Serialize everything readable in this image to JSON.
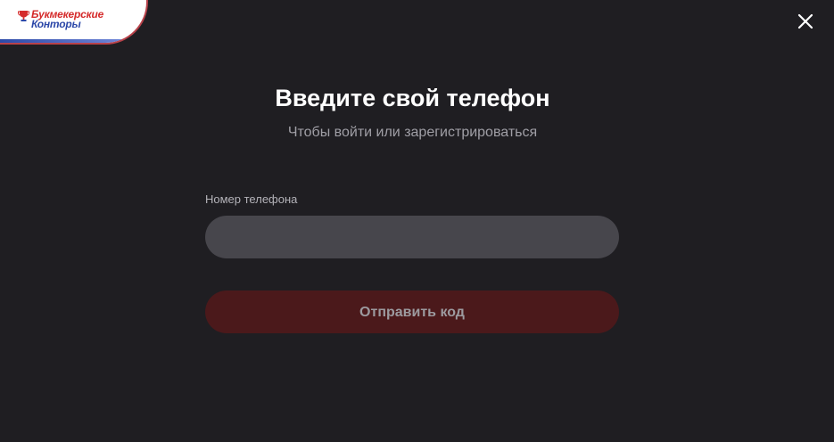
{
  "logo": {
    "line1": "Букмекерские",
    "line2": "Конторы",
    "icon": "trophy-icon"
  },
  "colors": {
    "background": "#1f1e22",
    "input_bg": "#47464c",
    "button_bg_disabled": "#4b191b",
    "title": "#ffffff",
    "subtitle": "#a09fa6",
    "logo_red": "#d52b2b",
    "logo_blue": "#2b47a8"
  },
  "close": {
    "icon": "close-icon"
  },
  "form": {
    "title": "Введите свой телефон",
    "subtitle": "Чтобы войти или зарегистрироваться",
    "phone_label": "Номер телефона",
    "phone_value": "",
    "phone_placeholder": "",
    "submit_label": "Отправить код",
    "submit_state": "disabled"
  }
}
